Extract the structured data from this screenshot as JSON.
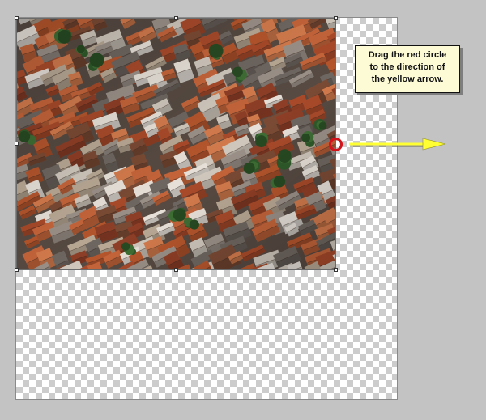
{
  "instruction": {
    "lines": [
      "Drag the red circle",
      "to the direction of",
      "the yellow arrow."
    ]
  },
  "colors": {
    "circle": "#d2141a",
    "arrow": "#ffff33",
    "callout_background": "#fdfbd6",
    "workspace": "#c3c3c3"
  },
  "icons": {
    "drag_target": "red-circle-icon",
    "direction": "yellow-arrow-icon"
  }
}
